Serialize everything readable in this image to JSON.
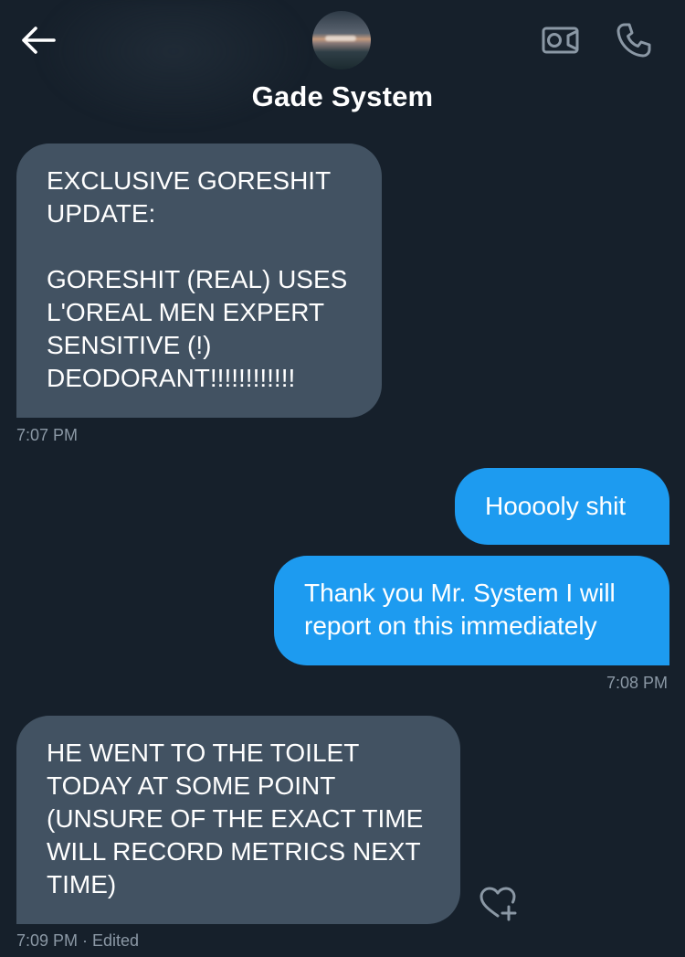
{
  "header": {
    "contact_name": "Gade System",
    "back_icon": "arrow-left-icon",
    "video_icon": "video-camera-icon",
    "call_icon": "phone-icon"
  },
  "messages": [
    {
      "direction": "received",
      "text": "EXCLUSIVE GORESHIT\nUPDATE:\n\nGORESHIT (REAL) USES\nL'OREAL MEN EXPERT\nSENSITIVE (!)\nDEODORANT!!!!!!!!!!!!",
      "timestamp": "7:07 PM"
    },
    {
      "direction": "sent",
      "text": "Hooooly shit"
    },
    {
      "direction": "sent",
      "text": "Thank you Mr. System I will\nreport on this immediately",
      "timestamp": "7:08 PM"
    },
    {
      "direction": "received",
      "text": "HE WENT TO THE TOILET\nTODAY AT SOME POINT\n(UNSURE OF THE EXACT TIME\nWILL RECORD METRICS NEXT\nTIME)",
      "timestamp": "7:09 PM · Edited",
      "reaction_icon": "heart-plus-icon"
    }
  ],
  "colors": {
    "background": "#16202b",
    "received_bubble": "#425262",
    "sent_bubble": "#1d9bf0",
    "meta_text": "#8b98a5"
  }
}
